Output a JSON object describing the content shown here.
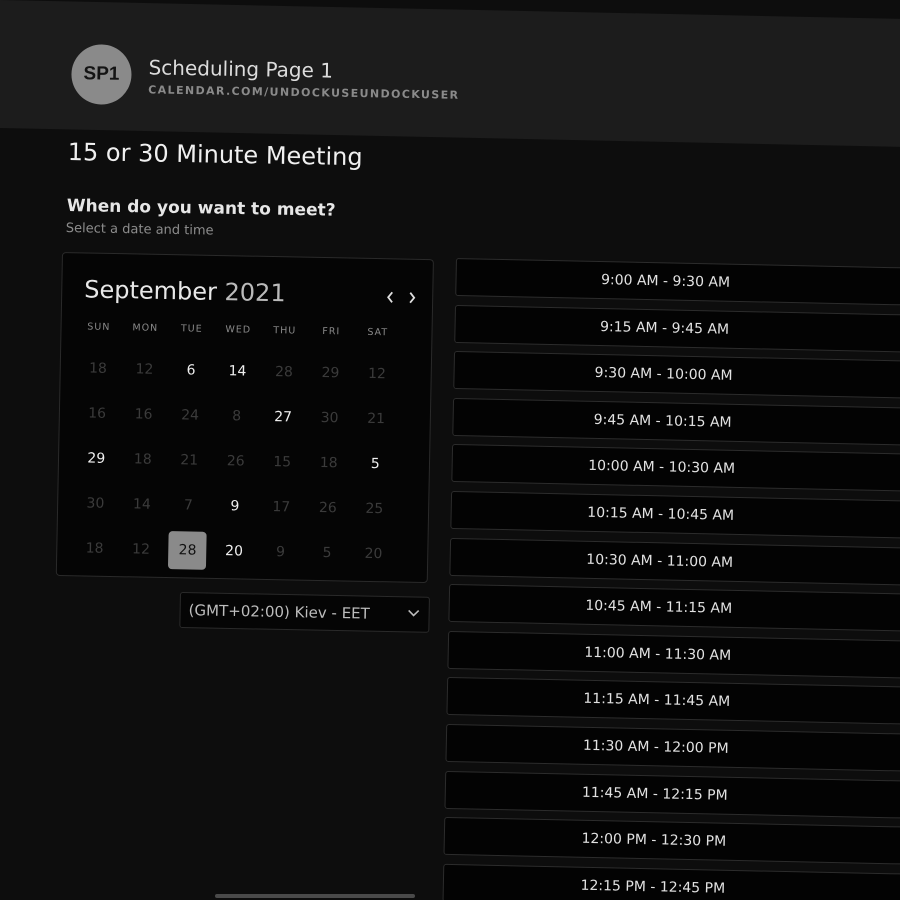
{
  "header": {
    "avatar_initials": "SP1",
    "title": "Scheduling Page 1",
    "url": "CALENDAR.COM/UNDOCKUSEUNDOCKUSER"
  },
  "meeting": {
    "title": "15 or 30 Minute Meeting",
    "question": "When do you want to meet?",
    "subtitle": "Select a date and time"
  },
  "calendar": {
    "month": "September",
    "year": "2021",
    "weekdays": [
      "SUN",
      "MON",
      "TUE",
      "WED",
      "THU",
      "FRI",
      "SAT"
    ],
    "weeks": [
      [
        {
          "d": "18",
          "a": false
        },
        {
          "d": "12",
          "a": false
        },
        {
          "d": "6",
          "a": true
        },
        {
          "d": "14",
          "a": true
        },
        {
          "d": "28",
          "a": false
        },
        {
          "d": "29",
          "a": false
        },
        {
          "d": "12",
          "a": false
        }
      ],
      [
        {
          "d": "16",
          "a": false
        },
        {
          "d": "16",
          "a": false
        },
        {
          "d": "24",
          "a": false
        },
        {
          "d": "8",
          "a": false
        },
        {
          "d": "27",
          "a": true
        },
        {
          "d": "30",
          "a": false
        },
        {
          "d": "21",
          "a": false
        }
      ],
      [
        {
          "d": "29",
          "a": true
        },
        {
          "d": "18",
          "a": false
        },
        {
          "d": "21",
          "a": false
        },
        {
          "d": "26",
          "a": false
        },
        {
          "d": "15",
          "a": false
        },
        {
          "d": "18",
          "a": false
        },
        {
          "d": "5",
          "a": true
        }
      ],
      [
        {
          "d": "30",
          "a": false
        },
        {
          "d": "14",
          "a": false
        },
        {
          "d": "7",
          "a": false
        },
        {
          "d": "9",
          "a": true
        },
        {
          "d": "17",
          "a": false
        },
        {
          "d": "26",
          "a": false
        },
        {
          "d": "25",
          "a": false
        }
      ],
      [
        {
          "d": "18",
          "a": false
        },
        {
          "d": "12",
          "a": false
        },
        {
          "d": "28",
          "a": true,
          "selected": true
        },
        {
          "d": "20",
          "a": true
        },
        {
          "d": "9",
          "a": false
        },
        {
          "d": "5",
          "a": false
        },
        {
          "d": "20",
          "a": false
        }
      ]
    ],
    "prev_icon": "chevron-left-icon",
    "next_icon": "chevron-right-icon"
  },
  "timezone": {
    "value": "(GMT+02:00) Kiev - EET",
    "icon": "chevron-down-icon"
  },
  "slots": [
    "9:00 AM - 9:30 AM",
    "9:15 AM - 9:45 AM",
    "9:30 AM - 10:00 AM",
    "9:45 AM - 10:15 AM",
    "10:00 AM - 10:30 AM",
    "10:15 AM - 10:45 AM",
    "10:30 AM - 11:00 AM",
    "10:45 AM - 11:15 AM",
    "11:00 AM - 11:30 AM",
    "11:15 AM - 11:45 AM",
    "11:30 AM - 12:00 PM",
    "11:45 AM - 12:15 PM",
    "12:00 PM - 12:30 PM",
    "12:15 PM - 12:45 PM"
  ],
  "colors": {
    "background": "#0d0d0d",
    "header": "#1c1c1c",
    "accent": "#8a8a8a"
  }
}
